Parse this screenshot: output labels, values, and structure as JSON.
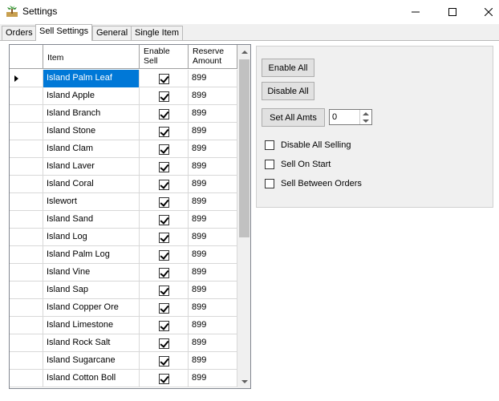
{
  "window": {
    "title": "Settings",
    "icon": "palm-tree-icon"
  },
  "tabs": [
    {
      "label": "Orders",
      "active": false
    },
    {
      "label": "Sell Settings",
      "active": true
    },
    {
      "label": "General",
      "active": false
    },
    {
      "label": "Single Item",
      "active": false
    }
  ],
  "grid": {
    "columns": {
      "item": "Item",
      "enable": "Enable Sell",
      "reserve": "Reserve Amount"
    },
    "rows": [
      {
        "item": "Island Palm Leaf",
        "enabled": true,
        "reserve": "899"
      },
      {
        "item": "Island Apple",
        "enabled": true,
        "reserve": "899"
      },
      {
        "item": "Island Branch",
        "enabled": true,
        "reserve": "899"
      },
      {
        "item": "Island Stone",
        "enabled": true,
        "reserve": "899"
      },
      {
        "item": "Island Clam",
        "enabled": true,
        "reserve": "899"
      },
      {
        "item": "Island Laver",
        "enabled": true,
        "reserve": "899"
      },
      {
        "item": "Island Coral",
        "enabled": true,
        "reserve": "899"
      },
      {
        "item": "Islewort",
        "enabled": true,
        "reserve": "899"
      },
      {
        "item": "Island Sand",
        "enabled": true,
        "reserve": "899"
      },
      {
        "item": "Island Log",
        "enabled": true,
        "reserve": "899"
      },
      {
        "item": "Island Palm Log",
        "enabled": true,
        "reserve": "899"
      },
      {
        "item": "Island Vine",
        "enabled": true,
        "reserve": "899"
      },
      {
        "item": "Island Sap",
        "enabled": true,
        "reserve": "899"
      },
      {
        "item": "Island Copper Ore",
        "enabled": true,
        "reserve": "899"
      },
      {
        "item": "Island Limestone",
        "enabled": true,
        "reserve": "899"
      },
      {
        "item": "Island Rock Salt",
        "enabled": true,
        "reserve": "899"
      },
      {
        "item": "Island Sugarcane",
        "enabled": true,
        "reserve": "899"
      },
      {
        "item": "Island Cotton Boll",
        "enabled": true,
        "reserve": "899"
      }
    ],
    "selected_row": 0
  },
  "panel": {
    "enable_all": "Enable All",
    "disable_all": "Disable All",
    "set_all_amts": "Set All Amts",
    "amount_value": "0",
    "options": [
      {
        "label": "Disable All Selling",
        "checked": false
      },
      {
        "label": "Sell On Start",
        "checked": false
      },
      {
        "label": "Sell Between Orders",
        "checked": false
      }
    ]
  },
  "colors": {
    "selection": "#0078d7",
    "panel_bg": "#f0f0f0"
  }
}
